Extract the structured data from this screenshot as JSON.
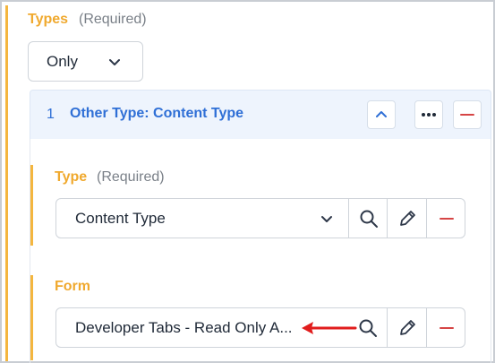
{
  "types_section": {
    "label": "Types",
    "required_text": "(Required)",
    "select_value": "Only"
  },
  "group": {
    "index": "1",
    "title": "Other Type: Content Type"
  },
  "type_field": {
    "label": "Type",
    "required_text": "(Required)",
    "value": "Content Type"
  },
  "form_field": {
    "label": "Form",
    "value": "Developer Tabs - Read Only A..."
  },
  "colors": {
    "accent": "#f4b63f",
    "label": "#f0a92e",
    "link_blue": "#2f6fd6",
    "danger": "#d64545",
    "annotation_arrow": "#e11d1d"
  },
  "icons": [
    "chevron-down-icon",
    "chevron-up-icon",
    "more-horizontal-icon",
    "minus-icon",
    "search-icon",
    "pencil-icon",
    "arrow-left-icon"
  ]
}
